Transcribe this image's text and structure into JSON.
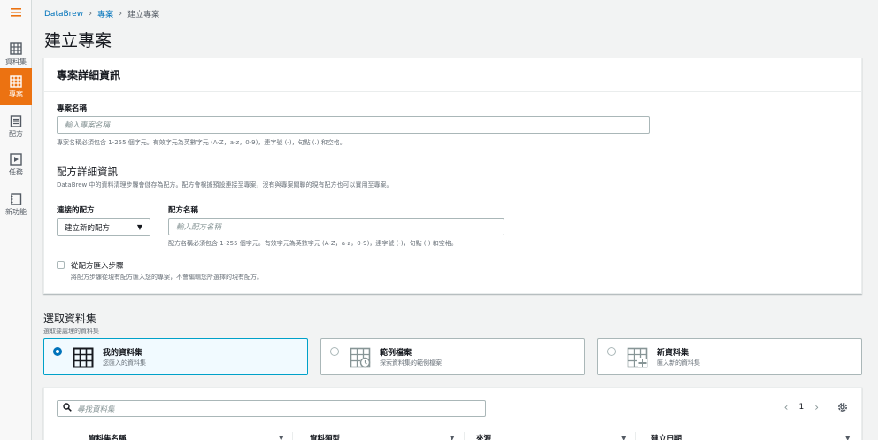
{
  "sidebar": {
    "items": [
      {
        "label": "資料集",
        "icon": "table-icon"
      },
      {
        "label": "專案",
        "icon": "project-grid-icon",
        "active": true
      },
      {
        "label": "配方",
        "icon": "recipe-icon"
      },
      {
        "label": "任務",
        "icon": "play-icon"
      },
      {
        "label": "新功能",
        "icon": "notebook-icon"
      }
    ]
  },
  "breadcrumb": {
    "items": [
      "DataBrew",
      "專案",
      "建立專案"
    ]
  },
  "page_title": "建立專案",
  "project_details": {
    "header": "專案詳細資訊",
    "name_label": "專案名稱",
    "name_placeholder": "輸入專案名稱",
    "name_hint": "專案名稱必須包含 1-255 個字元。有效字元為英數字元 (A-Z，a-z，0-9)，連字號 (-)，句點 (.) 和空格。",
    "recipe_header": "配方詳細資訊",
    "recipe_desc": "DataBrew 中的資料清理步驟會儲存為配方。配方會根據預設連接至專案，沒有與專案關聯的現有配方也可以實用至專案。",
    "attached_recipe_label": "連接的配方",
    "attached_recipe_value": "建立新的配方",
    "recipe_name_label": "配方名稱",
    "recipe_name_placeholder": "輸入配方名稱",
    "recipe_name_hint": "配方名稱必須包含 1-255 個字元。有效字元為英數字元 (A-Z，a-z，0-9)，連字號 (-)，句點 (.) 和空格。",
    "import_label": "從配方匯入步驟",
    "import_desc": "將配方步驟從現有配方匯入您的專案，不會編輯您所選擇的現有配方。"
  },
  "dataset_section": {
    "header": "選取資料集",
    "desc": "選取要處理的資料集",
    "options": [
      {
        "title": "我的資料集",
        "desc": "您匯入的資料集",
        "icon": "table-icon",
        "selected": true
      },
      {
        "title": "範例檔案",
        "desc": "探索資料集的範例檔案",
        "icon": "sample-table-icon",
        "selected": false
      },
      {
        "title": "新資料集",
        "desc": "匯入新的資料集",
        "icon": "add-table-icon",
        "selected": false
      }
    ]
  },
  "dataset_table": {
    "search_placeholder": "尋找資料集",
    "page": "1",
    "columns": [
      "資料集名稱",
      "資料類型",
      "來源",
      "建立日期"
    ]
  },
  "colors": {
    "accent": "#ec7211",
    "link": "#0073bb",
    "selected_border": "#00a1c9"
  }
}
